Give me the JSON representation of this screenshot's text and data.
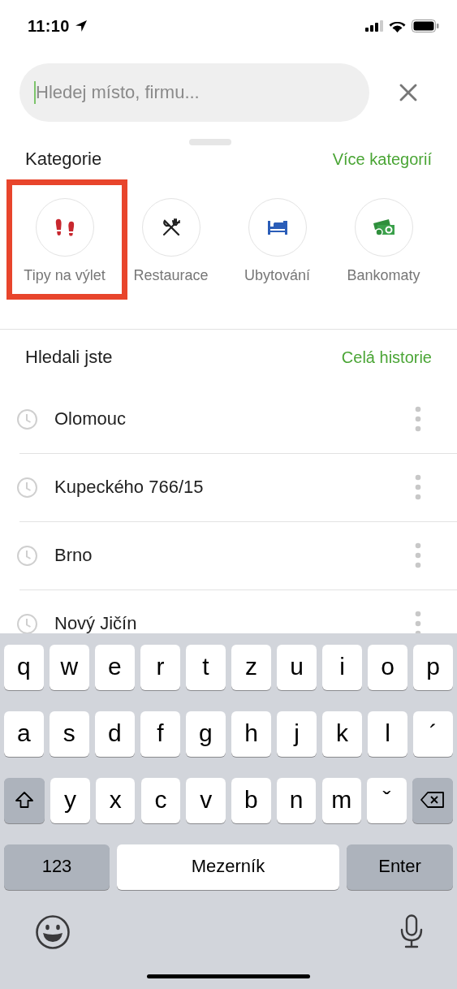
{
  "status_bar": {
    "time": "11:10"
  },
  "search": {
    "placeholder": "Hledej místo, firmu...",
    "focused": true
  },
  "categories_header": {
    "title": "Kategorie",
    "link": "Více kategorií"
  },
  "categories": [
    {
      "label": "Tipy na výlet",
      "kind": "trips",
      "highlighted": true
    },
    {
      "label": "Restaurace",
      "kind": "restaurant",
      "highlighted": false
    },
    {
      "label": "Ubytování",
      "kind": "hotel",
      "highlighted": false
    },
    {
      "label": "Bankomaty",
      "kind": "atm",
      "highlighted": false
    }
  ],
  "history_header": {
    "title": "Hledali jste",
    "link": "Celá historie"
  },
  "history": [
    {
      "label": "Olomouc"
    },
    {
      "label": "Kupeckého 766/15"
    },
    {
      "label": "Brno"
    },
    {
      "label": "Nový Jičín"
    }
  ],
  "keyboard": {
    "row_1": [
      {
        "kind": "letter",
        "label": "q"
      },
      {
        "kind": "letter",
        "label": "w"
      },
      {
        "kind": "letter",
        "label": "e"
      },
      {
        "kind": "letter",
        "label": "r"
      },
      {
        "kind": "letter",
        "label": "t"
      },
      {
        "kind": "letter",
        "label": "z"
      },
      {
        "kind": "letter",
        "label": "u"
      },
      {
        "kind": "letter",
        "label": "i"
      },
      {
        "kind": "letter",
        "label": "o"
      },
      {
        "kind": "letter",
        "label": "p"
      }
    ],
    "row_2": [
      {
        "kind": "letter",
        "label": "a"
      },
      {
        "kind": "letter",
        "label": "s"
      },
      {
        "kind": "letter",
        "label": "d"
      },
      {
        "kind": "letter",
        "label": "f"
      },
      {
        "kind": "letter",
        "label": "g"
      },
      {
        "kind": "letter",
        "label": "h"
      },
      {
        "kind": "letter",
        "label": "j"
      },
      {
        "kind": "letter",
        "label": "k"
      },
      {
        "kind": "letter",
        "label": "l"
      },
      {
        "kind": "letter",
        "label": "´"
      }
    ],
    "row_3": [
      {
        "kind": "shift"
      },
      {
        "kind": "letter",
        "label": "y"
      },
      {
        "kind": "letter",
        "label": "x"
      },
      {
        "kind": "letter",
        "label": "c"
      },
      {
        "kind": "letter",
        "label": "v"
      },
      {
        "kind": "letter",
        "label": "b"
      },
      {
        "kind": "letter",
        "label": "n"
      },
      {
        "kind": "letter",
        "label": "m"
      },
      {
        "kind": "letter",
        "label": "ˇ"
      },
      {
        "kind": "backspace"
      }
    ],
    "row_4": [
      {
        "kind": "numbers",
        "label": "123"
      },
      {
        "kind": "space",
        "label": "Mezerník"
      },
      {
        "kind": "enter",
        "label": "Enter"
      }
    ],
    "bottom": [
      {
        "kind": "emoji"
      },
      {
        "kind": "mic"
      }
    ]
  }
}
